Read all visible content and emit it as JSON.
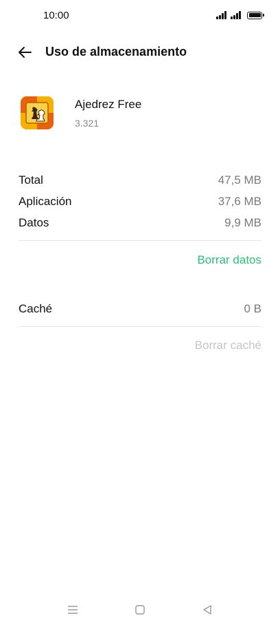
{
  "status_bar": {
    "time": "10:00",
    "icons": [
      "signal-1-icon",
      "signal-2-icon",
      "battery-icon"
    ]
  },
  "header": {
    "back_icon": "arrow-left-icon",
    "title": "Uso de almacenamiento"
  },
  "app": {
    "icon": "chess-app-icon",
    "name": "Ajedrez Free",
    "version": "3.321"
  },
  "storage": {
    "rows": [
      {
        "label": "Total",
        "value": "47,5 MB"
      },
      {
        "label": "Aplicación",
        "value": "37,6 MB"
      },
      {
        "label": "Datos",
        "value": "9,9 MB"
      }
    ],
    "clear_data_label": "Borrar datos"
  },
  "cache": {
    "label": "Caché",
    "value": "0 B",
    "clear_cache_label": "Borrar caché"
  },
  "nav_bar": {
    "icons": [
      "menu-icon",
      "home-icon",
      "back-triangle-icon"
    ]
  },
  "colors": {
    "accent": "#2bc07a",
    "disabled": "#c6c6c6",
    "secondary_text": "#7a7a7a"
  }
}
